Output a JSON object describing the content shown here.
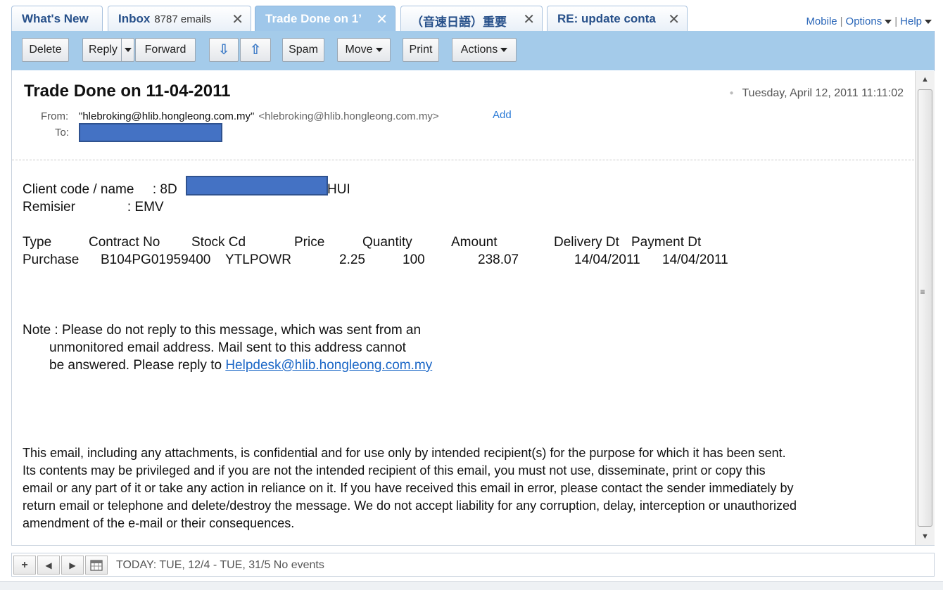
{
  "tabs": [
    {
      "label": "What's New",
      "count": "",
      "active": false
    },
    {
      "label": "Inbox",
      "count": "8787 emails",
      "active": false
    },
    {
      "label": "Trade Done on 1’",
      "count": "",
      "active": true
    },
    {
      "label": "（音速日語）重要",
      "count": "",
      "active": false
    },
    {
      "label": "RE: update conta",
      "count": "",
      "active": false
    }
  ],
  "top_links": {
    "mobile": "Mobile",
    "options": "Options",
    "help": "Help",
    "sep": "|"
  },
  "toolbar": {
    "delete": "Delete",
    "reply": "Reply",
    "forward": "Forward",
    "next_icon": "⇩",
    "prev_icon": "⇧",
    "spam": "Spam",
    "move": "Move",
    "print": "Print",
    "actions": "Actions"
  },
  "message": {
    "subject": "Trade Done on 11-04-2011",
    "date": "Tuesday, April 12, 2011 11:11:02",
    "from_label": "From:",
    "to_label": "To:",
    "from_name": "\"hlebroking@hlib.hongleong.com.my\"",
    "from_addr": "<hlebroking@hlib.hongleong.com.my>",
    "add_link": "Add"
  },
  "body": {
    "client_label": "Client code / name     : 8D",
    "client_suffix": "HUI",
    "remisier": "Remisier              : EMV",
    "table": {
      "headers": [
        "Type",
        "Contract No",
        "Stock Cd",
        "Price",
        "Quantity",
        "Amount",
        "Delivery Dt",
        "Payment Dt"
      ],
      "row": [
        "Purchase",
        "B104PG01959400",
        "YTLPOWR",
        "2.25",
        "100",
        "238.07",
        "14/04/2011",
        "14/04/2011"
      ]
    },
    "note_line1": "Note : Please do not reply to this message, which was sent from an",
    "note_line2": "unmonitored email address. Mail sent to this address cannot",
    "note_line3_prefix": "be answered. Please reply to ",
    "note_link": "Helpdesk@hlib.hongleong.com.my",
    "disclaimer": [
      "This email, including any attachments, is confidential and for use only by intended recipient(s) for the purpose for which it has been sent.",
      "Its contents may be privileged and if you are not the intended recipient of this email, you must not use, disseminate, print or copy this",
      "email or any part of it or take any action in reliance on it. If you have received this email in error, please contact the sender immediately by",
      "return email or telephone and delete/destroy the message. We do not accept liability for any corruption, delay, interception or unauthorized",
      "amendment of the e-mail or their consequences."
    ]
  },
  "calendar": {
    "add_icon": "+",
    "prev_icon": "◀",
    "next_icon": "▶",
    "text": "TODAY: TUE, 12/4 - TUE, 31/5   No events"
  },
  "colors": {
    "tab_active": "#9fc7ea",
    "toolbar": "#a4cbea",
    "link": "#1a66c6",
    "redaction": "#4472c4"
  }
}
